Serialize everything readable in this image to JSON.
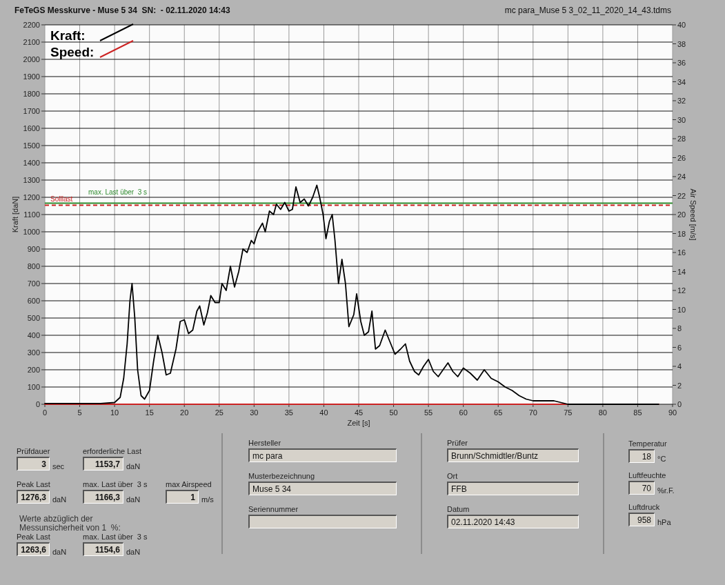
{
  "window": {
    "title": "FeTeGS Messkurve - Muse 5 34  SN:  - 02.11.2020 14:43",
    "file": "mc para_Muse 5 3_02_11_2020_14_43.tdms"
  },
  "chart": {
    "chart_data": {
      "type": "line",
      "xlabel": "Zeit [s]",
      "ylabel": "Kraft [daN]",
      "y2label": "Air Speed [m/s]",
      "xlim": [
        0,
        90
      ],
      "ylim": [
        0,
        2200
      ],
      "y2lim": [
        0,
        40
      ],
      "xticks": [
        0,
        5,
        10,
        15,
        20,
        25,
        30,
        35,
        40,
        45,
        50,
        55,
        60,
        65,
        70,
        75,
        80,
        85,
        90
      ],
      "yticks": [
        0,
        100,
        200,
        300,
        400,
        500,
        600,
        700,
        800,
        900,
        1000,
        1100,
        1200,
        1300,
        1400,
        1500,
        1600,
        1700,
        1800,
        1900,
        2000,
        2100,
        2200
      ],
      "y2ticks": [
        0,
        2,
        4,
        6,
        8,
        10,
        12,
        14,
        16,
        18,
        20,
        22,
        24,
        26,
        28,
        30,
        32,
        34,
        36,
        38,
        40
      ],
      "x": [
        0,
        5,
        8,
        10,
        10.8,
        11.3,
        11.8,
        12.2,
        12.5,
        12.9,
        13.3,
        13.8,
        14.3,
        15,
        15.6,
        16.2,
        16.8,
        17.4,
        18,
        18.8,
        19.4,
        20,
        20.6,
        21.2,
        21.8,
        22.2,
        22.8,
        23.3,
        23.8,
        24.4,
        25,
        25.4,
        26,
        26.6,
        27.2,
        27.8,
        28.4,
        29,
        29.6,
        30,
        30.5,
        31.2,
        31.6,
        32.2,
        32.8,
        33.2,
        33.8,
        34.4,
        35,
        35.5,
        36,
        36.6,
        37.2,
        37.8,
        38.4,
        39,
        39.4,
        39.9,
        40.3,
        40.8,
        41.2,
        41.6,
        42.1,
        42.6,
        43.1,
        43.6,
        44.3,
        44.7,
        45.3,
        45.8,
        46.4,
        46.9,
        47.4,
        48,
        48.8,
        49.5,
        50.2,
        51,
        51.7,
        52.3,
        53,
        53.6,
        54.3,
        55,
        55.7,
        56.4,
        57.1,
        57.8,
        58.5,
        59.2,
        60,
        61,
        62,
        63,
        64,
        65,
        66,
        67,
        68,
        69,
        70,
        71,
        72,
        73,
        74,
        75,
        80,
        88
      ],
      "series": [
        {
          "name": "Kraft:",
          "color": "#000000",
          "values": [
            5,
            5,
            5,
            10,
            40,
            150,
            350,
            600,
            700,
            500,
            200,
            50,
            30,
            80,
            250,
            400,
            300,
            170,
            180,
            320,
            480,
            490,
            410,
            430,
            540,
            570,
            460,
            530,
            630,
            590,
            590,
            700,
            660,
            800,
            680,
            770,
            900,
            880,
            950,
            930,
            1000,
            1050,
            1000,
            1120,
            1100,
            1160,
            1130,
            1170,
            1120,
            1130,
            1260,
            1170,
            1190,
            1150,
            1200,
            1270,
            1200,
            1100,
            960,
            1060,
            1100,
            950,
            700,
            840,
            700,
            450,
            520,
            640,
            480,
            400,
            420,
            540,
            320,
            340,
            430,
            360,
            290,
            320,
            350,
            250,
            190,
            170,
            220,
            260,
            190,
            160,
            200,
            240,
            190,
            160,
            210,
            180,
            140,
            200,
            150,
            130,
            100,
            80,
            50,
            30,
            20,
            20,
            20,
            20,
            10,
            0,
            0,
            0
          ]
        },
        {
          "name": "Speed:",
          "color": "#cc2222",
          "values": [
            0,
            0,
            0,
            0,
            0,
            0,
            0,
            0,
            0,
            0,
            0,
            0,
            0,
            0,
            0,
            0,
            0,
            0,
            0,
            0,
            0,
            0,
            0,
            0,
            0,
            0,
            0,
            0,
            0,
            0,
            0,
            0,
            0,
            0,
            0,
            0,
            0,
            0,
            0,
            0,
            0,
            0,
            0,
            0,
            0,
            0,
            0,
            0,
            0,
            0,
            0,
            0,
            0,
            0,
            0,
            0,
            0,
            0,
            0,
            0,
            0,
            0,
            0,
            0,
            0,
            0,
            0,
            0,
            0,
            0,
            0,
            0,
            0,
            0,
            0,
            0,
            0,
            0,
            0,
            0,
            0,
            0,
            0,
            0,
            0,
            0,
            0,
            0,
            0,
            0,
            0,
            0,
            0,
            0,
            0,
            0,
            0,
            0,
            0,
            0,
            0,
            0,
            0,
            0,
            0,
            0,
            0,
            0
          ]
        }
      ],
      "grid": true,
      "legend": true,
      "ref_lines": [
        {
          "axis": "y",
          "label": "Solllast",
          "value": 1153.7,
          "color": "#cc2222"
        },
        {
          "axis": "y",
          "label": "max. Last über  3 s",
          "value": 1166.3,
          "color": "#2e8b2e"
        }
      ]
    }
  },
  "results": {
    "rows": [
      [
        {
          "label": "Prüfdauer",
          "value": "3",
          "unit": "sec"
        },
        {
          "label": "erforderliche Last",
          "value": "1153,7",
          "unit": "daN"
        }
      ],
      [
        {
          "label": "Peak Last",
          "value": "1276,3",
          "unit": "daN"
        },
        {
          "label": "max. Last über  3 s",
          "value": "1166,3",
          "unit": "daN"
        },
        {
          "label": "max Airspeed",
          "value": "1",
          "unit": "m/s"
        }
      ]
    ],
    "note": "Werte abzüglich der Messunsicherheit von 1  %:",
    "corrected_rows": [
      [
        {
          "label": "Peak Last",
          "value": "1263,6",
          "unit": "daN"
        },
        {
          "label": "max. Last über  3 s",
          "value": "1154,6",
          "unit": "daN"
        }
      ]
    ]
  },
  "info_columns": [
    [
      {
        "label": "Hersteller",
        "value": "mc para"
      },
      {
        "label": "Musterbezeichnung",
        "value": "Muse 5 34"
      },
      {
        "label": "Seriennummer"
      }
    ],
    [
      {
        "label": "Prüfer",
        "value": "Brunn/Schmidtler/Buntz"
      },
      {
        "label": "Ort",
        "value": "FFB"
      },
      {
        "label": "Datum",
        "value": "02.11.2020 14:43"
      }
    ]
  ],
  "environment": [
    {
      "label": "Temperatur",
      "value": "18",
      "unit": "°C"
    },
    {
      "label": "Luftfeuchte",
      "value": "70",
      "unit": "%r.F."
    },
    {
      "label": "Luftdruck",
      "value": "958",
      "unit": "hPa"
    }
  ]
}
